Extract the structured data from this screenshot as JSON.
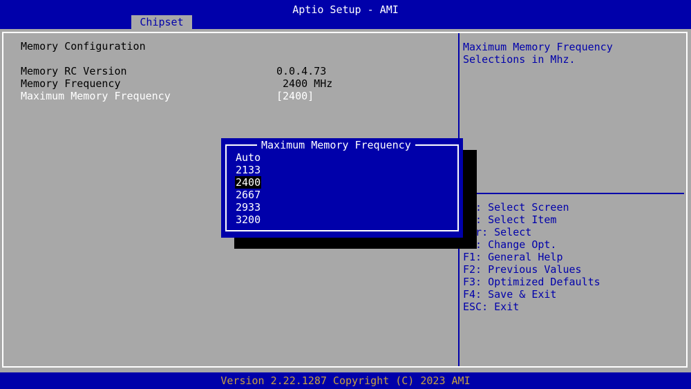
{
  "header": {
    "title": "Aptio Setup - AMI",
    "tab": "Chipset"
  },
  "main": {
    "section_title": "Memory Configuration",
    "rows": [
      {
        "label": "Memory RC Version",
        "value": "0.0.4.73"
      },
      {
        "label": "Memory Frequency",
        "value": " 2400 MHz"
      },
      {
        "label": "Maximum Memory Frequency",
        "value": "[2400]"
      }
    ]
  },
  "help": {
    "description_line1": "Maximum Memory Frequency",
    "description_line2": "Selections in Mhz.",
    "keys": [
      "  : Select Screen",
      "  : Select Item",
      "ter: Select",
      " -: Change Opt.",
      "F1: General Help",
      "F2: Previous Values",
      "F3: Optimized Defaults",
      "F4: Save & Exit",
      "ESC: Exit"
    ]
  },
  "popup": {
    "title": "Maximum Memory Frequency",
    "options": [
      "Auto",
      "2133",
      "2400",
      "2667",
      "2933",
      "3200"
    ],
    "selected": "2400"
  },
  "footer": {
    "text": "Version 2.22.1287 Copyright (C) 2023 AMI"
  },
  "colors": {
    "bios_blue": "#0000aa",
    "bios_gray": "#a8a8a8",
    "white": "#ffffff",
    "footer_text": "#c8a040"
  }
}
